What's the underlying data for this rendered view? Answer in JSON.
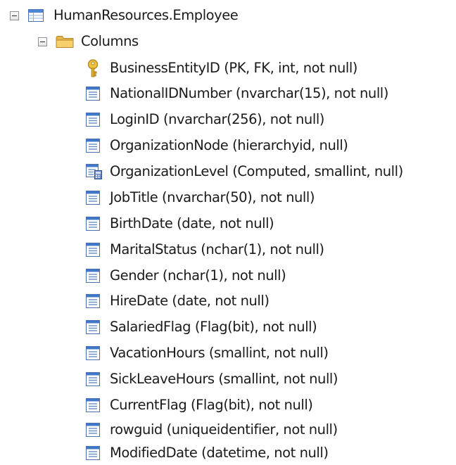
{
  "table": {
    "label": "HumanResources.Employee",
    "icon": "table-icon",
    "expanded": true
  },
  "columns_folder": {
    "label": "Columns",
    "icon": "folder-icon",
    "expanded": true
  },
  "columns": [
    {
      "label": "BusinessEntityID (PK, FK, int, not null)",
      "icon": "key-icon"
    },
    {
      "label": "NationalIDNumber (nvarchar(15), not null)",
      "icon": "column-icon"
    },
    {
      "label": "LoginID (nvarchar(256), not null)",
      "icon": "column-icon"
    },
    {
      "label": "OrganizationNode (hierarchyid, null)",
      "icon": "column-icon"
    },
    {
      "label": "OrganizationLevel (Computed, smallint, null)",
      "icon": "computed-column-icon"
    },
    {
      "label": "JobTitle (nvarchar(50), not null)",
      "icon": "column-icon"
    },
    {
      "label": "BirthDate (date, not null)",
      "icon": "column-icon"
    },
    {
      "label": "MaritalStatus (nchar(1), not null)",
      "icon": "column-icon"
    },
    {
      "label": "Gender (nchar(1), not null)",
      "icon": "column-icon"
    },
    {
      "label": "HireDate (date, not null)",
      "icon": "column-icon"
    },
    {
      "label": "SalariedFlag (Flag(bit), not null)",
      "icon": "column-icon"
    },
    {
      "label": "VacationHours (smallint, not null)",
      "icon": "column-icon"
    },
    {
      "label": "SickLeaveHours (smallint, not null)",
      "icon": "column-icon"
    },
    {
      "label": "CurrentFlag (Flag(bit), not null)",
      "icon": "column-icon"
    },
    {
      "label": "rowguid (uniqueidentifier, not null)",
      "icon": "column-icon"
    },
    {
      "label": "ModifiedDate (datetime, not null)",
      "icon": "column-icon"
    }
  ]
}
